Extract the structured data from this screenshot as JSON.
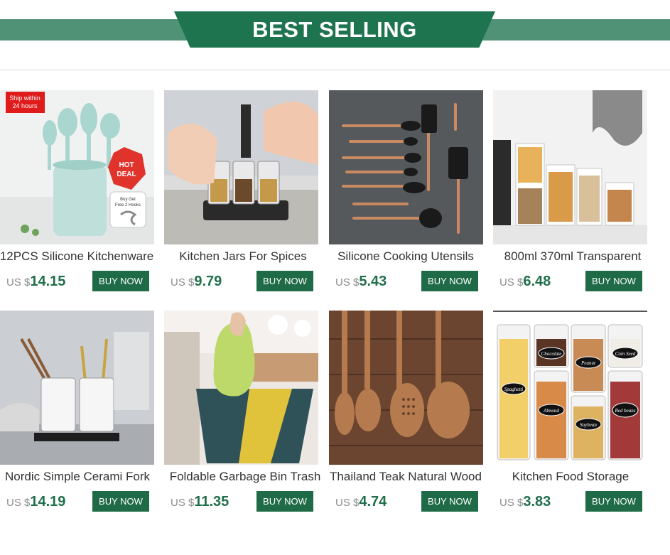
{
  "header": {
    "title": "BEST SELLING"
  },
  "products": [
    {
      "name": "12PCS Silicone Kitchenware",
      "currency": "US $",
      "price": "14.15",
      "cta": "BUY NOW",
      "badges": {
        "ship": "Ship within 24 hours",
        "deal": "HOT DEAL",
        "gift": "Buy Get Free 2 Hooks"
      }
    },
    {
      "name": "Kitchen Jars For Spices",
      "currency": "US $",
      "price": "9.79",
      "cta": "BUY NOW"
    },
    {
      "name": "Silicone Cooking Utensils",
      "currency": "US $",
      "price": "5.43",
      "cta": "BUY NOW"
    },
    {
      "name": "800ml 370ml Transparent",
      "currency": "US $",
      "price": "6.48",
      "cta": "BUY NOW"
    },
    {
      "name": "Nordic Simple Cerami Fork",
      "currency": "US $",
      "price": "14.19",
      "cta": "BUY NOW"
    },
    {
      "name": "Foldable Garbage Bin Trash",
      "currency": "US $",
      "price": "11.35",
      "cta": "BUY NOW"
    },
    {
      "name": "Thailand Teak Natural Wood",
      "currency": "US $",
      "price": "4.74",
      "cta": "BUY NOW"
    },
    {
      "name": "Kitchen Food Storage",
      "currency": "US $",
      "price": "3.83",
      "cta": "BUY NOW",
      "jar_labels": [
        "Spaghetti",
        "Chocolate",
        "Peanut",
        "Coin Seed",
        "Almond",
        "Soybean",
        "Red beans"
      ]
    }
  ],
  "colors": {
    "brand": "#1f7450",
    "banner_stripe": "#4f9276",
    "price": "#1f6f4a",
    "button": "#1f6b47"
  }
}
